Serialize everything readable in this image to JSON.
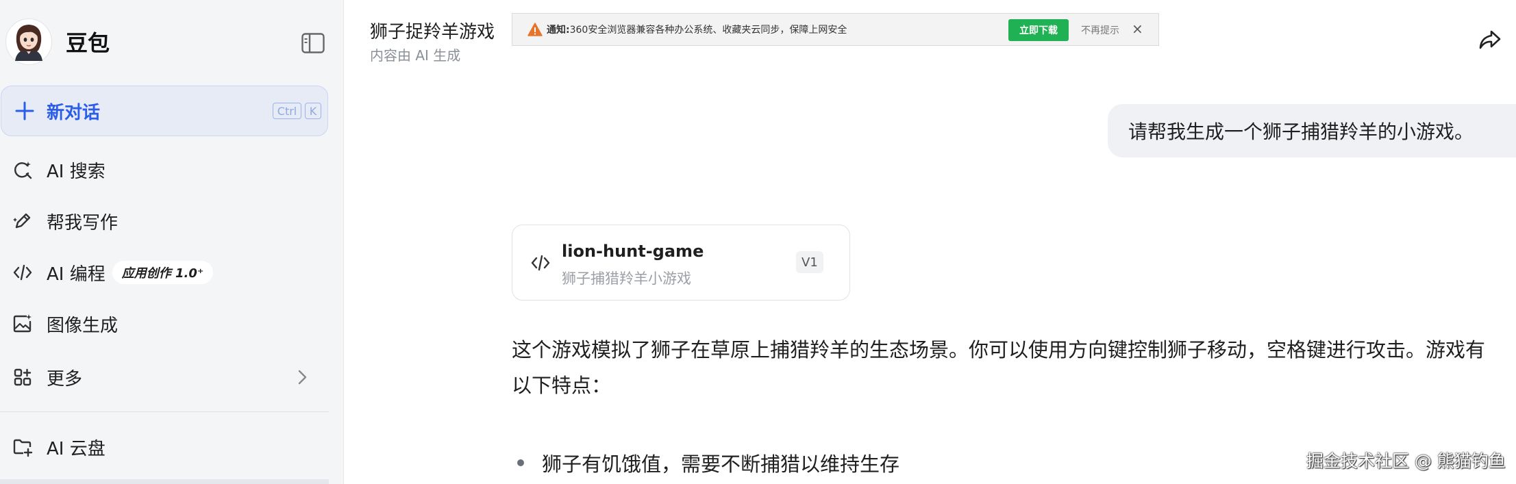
{
  "brand": {
    "name": "豆包"
  },
  "sidebar": {
    "new_chat": {
      "label": "新对话",
      "kbd_ctrl": "Ctrl",
      "kbd_key": "K"
    },
    "items": [
      {
        "label": "AI 搜索",
        "icon": "ai-search-icon"
      },
      {
        "label": "帮我写作",
        "icon": "pen-icon"
      },
      {
        "label": "AI 编程",
        "icon": "code-icon",
        "badge": "应用创作 1.0⁺"
      },
      {
        "label": "图像生成",
        "icon": "image-icon"
      },
      {
        "label": "更多",
        "icon": "apps-icon"
      },
      {
        "label": "AI 云盘",
        "icon": "cloud-folder-icon"
      }
    ]
  },
  "header": {
    "title": "狮子捉羚羊游戏",
    "subtitle": "内容由 AI 生成"
  },
  "notice": {
    "title": "通知:",
    "text": "360安全浏览器兼容各种办公系统、收藏夹云同步，保障上网安全",
    "download_label": "立即下载",
    "dismiss_label": "不再提示",
    "close_glyph": "×"
  },
  "chat": {
    "user_message": "请帮我生成一个狮子捕猎羚羊的小游戏。",
    "artifact": {
      "title": "lion-hunt-game",
      "subtitle": "狮子捕猎羚羊小游戏",
      "version": "V1"
    },
    "paragraph_line1": "这个游戏模拟了狮子在草原上捕猎羚羊的生态场景。你可以使用方向键控制狮子移动，空格键进行攻击。游戏有",
    "paragraph_line2": "以下特点：",
    "bullets": [
      "狮子有饥饿值，需要不断捕猎以维持生存"
    ]
  },
  "watermark": "掘金技术社区 @ 熊猫钓鱼",
  "colors": {
    "accent": "#2b5ee8",
    "sidebar_bg": "#f4f5f7",
    "download_green": "#1fb153",
    "warning": "#e8742c"
  }
}
